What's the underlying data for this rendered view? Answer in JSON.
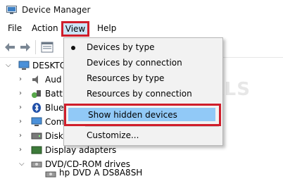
{
  "window": {
    "title": "Device Manager"
  },
  "menubar": {
    "file": "File",
    "action": "Action",
    "view": "View",
    "help": "Help"
  },
  "tree": {
    "root": "DESKTO",
    "items": [
      {
        "label": "Aud",
        "icon": "audio-icon"
      },
      {
        "label": "Batt",
        "icon": "battery-icon"
      },
      {
        "label": "Blue",
        "icon": "bluetooth-icon"
      },
      {
        "label": "Com",
        "icon": "computer-icon"
      },
      {
        "label": "Disk",
        "icon": "disk-icon"
      },
      {
        "label": "Display adapters",
        "icon": "display-icon"
      },
      {
        "label": "DVD/CD-ROM drives",
        "icon": "dvd-icon"
      },
      {
        "label": "hp DVD A  DS8A8SH",
        "icon": "dvd-icon"
      }
    ]
  },
  "view_menu": {
    "items": [
      {
        "label": "Devices by type",
        "checked": true
      },
      {
        "label": "Devices by connection"
      },
      {
        "label": "Resources by type"
      },
      {
        "label": "Resources by connection"
      },
      {
        "label": "Show hidden devices",
        "highlighted": true
      },
      {
        "label": "Customize..."
      }
    ]
  },
  "watermark": "APPUALS",
  "colors": {
    "highlight_border": "#d01e2b",
    "hover": "#91c9f7",
    "menu_bg": "#f2f2f2"
  }
}
